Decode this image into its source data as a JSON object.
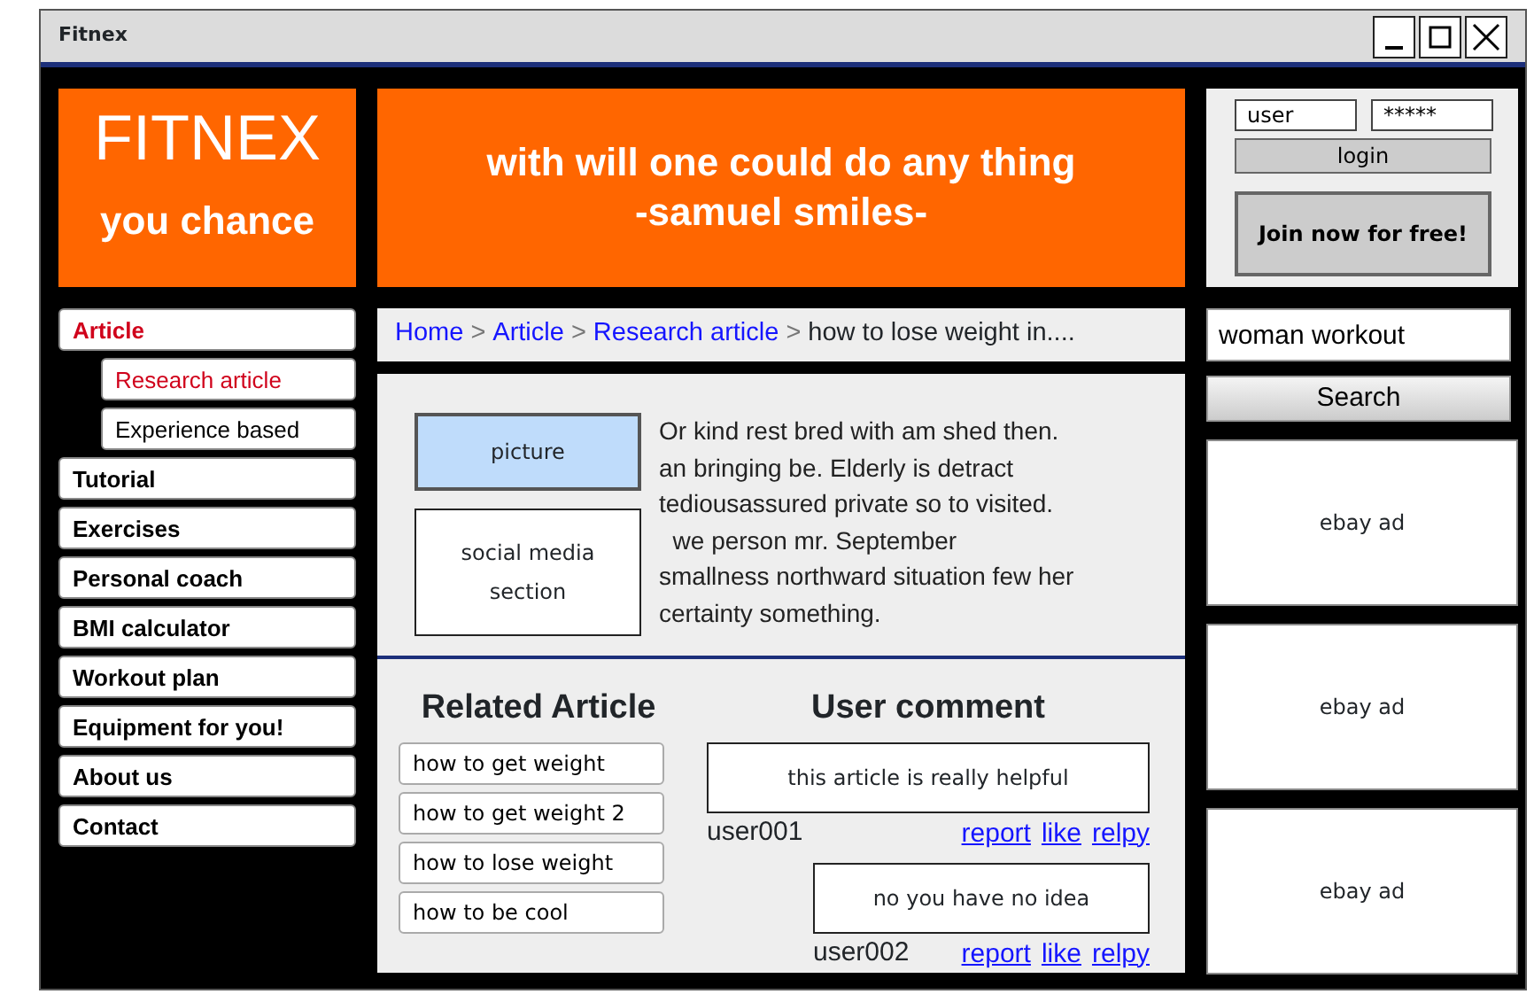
{
  "window": {
    "title": "Fitnex"
  },
  "logo": {
    "title": "FITNEX",
    "subtitle": "you chance"
  },
  "banner": {
    "lines": [
      "with will one could do any thing",
      "-samuel smiles-"
    ]
  },
  "login": {
    "username": "user",
    "password": "*****",
    "login_button": "login",
    "join_button": "Join now for free!"
  },
  "nav": [
    {
      "label": "Article",
      "selected": true,
      "children": [
        {
          "label": "Research article",
          "selected": true
        },
        {
          "label": "Experience based",
          "selected": false
        }
      ]
    },
    {
      "label": "Tutorial",
      "selected": false
    },
    {
      "label": "Exercises",
      "selected": false
    },
    {
      "label": "Personal coach",
      "selected": false
    },
    {
      "label": "BMI calculator",
      "selected": false
    },
    {
      "label": "Workout plan",
      "selected": false
    },
    {
      "label": "Equipment for you!",
      "selected": false
    },
    {
      "label": "About us",
      "selected": false
    },
    {
      "label": "Contact",
      "selected": false
    }
  ],
  "breadcrumb": [
    {
      "label": "Home",
      "kind": "link"
    },
    {
      "label": ">",
      "kind": "separator"
    },
    {
      "label": "Article",
      "kind": "link"
    },
    {
      "label": ">",
      "kind": "separator"
    },
    {
      "label": "Research article",
      "kind": "link"
    },
    {
      "label": ">",
      "kind": "separator"
    },
    {
      "label": "how to lose weight in....",
      "kind": "current"
    }
  ],
  "search": {
    "value": "woman workout",
    "button": "Search"
  },
  "ads": [
    "ebay ad",
    "ebay ad",
    "ebay ad"
  ],
  "article": {
    "picture_label": "picture",
    "social_label": "social media section",
    "body_lines": [
      "Or kind rest bred with am shed then.",
      "an bringing be. Elderly is detract",
      "tediousassured private so to visited.",
      "  we person mr. September",
      "smallness northward situation few her",
      "certainty something."
    ]
  },
  "related": {
    "title": "Related Article",
    "items": [
      "how to get weight",
      "how to get weight 2",
      "how to lose weight",
      "how to be cool"
    ]
  },
  "comments": {
    "title": "User comment",
    "items": [
      {
        "kind": "comment",
        "text": "this article is really helpful",
        "user": "user001",
        "actions": [
          "report",
          "like",
          "relpy"
        ]
      },
      {
        "kind": "reply",
        "text": "no you have no idea",
        "user": "user002",
        "actions": [
          "report",
          "like",
          "relpy"
        ]
      }
    ]
  }
}
